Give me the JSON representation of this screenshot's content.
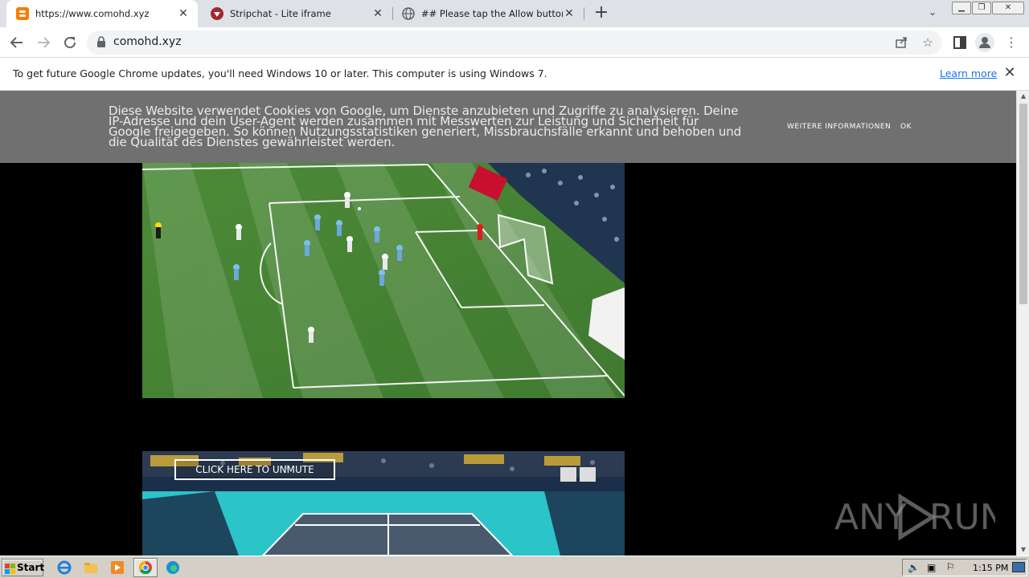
{
  "tabs": [
    {
      "title": "https://www.comohd.xyz",
      "active": true
    },
    {
      "title": "Stripchat - Lite iframe",
      "active": false
    },
    {
      "title": "## Please tap the Allow button to c",
      "active": false
    }
  ],
  "address_bar": {
    "url": "comohd.xyz"
  },
  "infobar": {
    "message": "To get future Google Chrome updates, you'll need Windows 10 or later. This computer is using Windows 7.",
    "link": "Learn more"
  },
  "cookie_banner": {
    "text": "Diese Website verwendet Cookies von Google, um Dienste anzubieten und Zugriffe zu analysieren. Deine IP-Adresse und dein User-Agent werden zusammen mit Messwerten zur Leistung und Sicherheit für Google freigegeben. So können Nutzungsstatistiken generiert, Missbrauchsfälle erkannt und behoben und die Qualität des Dienstes gewährleistet werden.",
    "more_info": "WEITERE INFORMATIONEN",
    "ok": "OK"
  },
  "video2": {
    "unmute_label": "CLICK HERE TO UNMUTE"
  },
  "watermark": {
    "text": "ANY RUN"
  },
  "taskbar": {
    "start_label": "Start",
    "time": "1:15 PM"
  },
  "colors": {
    "tab_strip": "#dee1e6",
    "cookie_bg": "#707070",
    "pitch_green": "#4f8a3c",
    "tennis_court": "#2bc4c8"
  }
}
